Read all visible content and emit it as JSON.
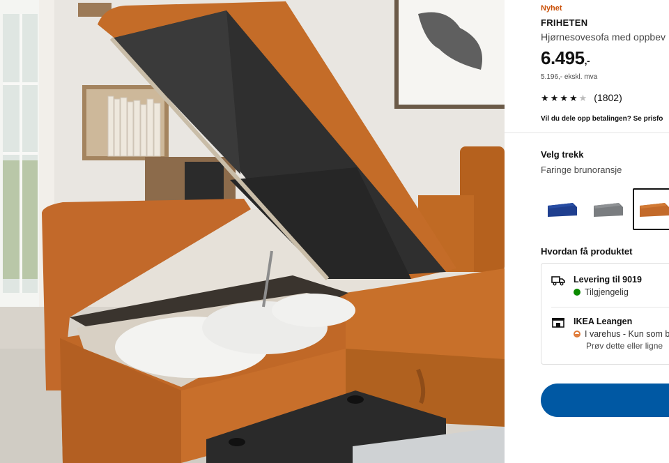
{
  "product": {
    "badge": "Nyhet",
    "name": "FRIHETEN",
    "description": "Hjørnesovesofa med oppbev",
    "price": "6.495",
    "price_suffix": ",-",
    "price_ex_vat": "5.196,- ekskl. mva",
    "rating": 4,
    "rating_max": 5,
    "rating_count": "(1802)",
    "payment_text": "Vil du dele opp betalingen? Se prisfo"
  },
  "cover": {
    "title": "Velg trekk",
    "selected_value": "Faringe brunoransje",
    "swatches": [
      {
        "name": "blue",
        "color": "#1f3f8f"
      },
      {
        "name": "grey",
        "color": "#7a7d80"
      },
      {
        "name": "brown-orange",
        "color": "#c36a2a",
        "selected": true
      }
    ]
  },
  "delivery": {
    "title": "Hvordan få produktet",
    "shipping": {
      "label": "Levering til 9019",
      "status": "Tilgjengelig",
      "status_color": "#0a8a00",
      "icon": "truck-icon"
    },
    "store": {
      "label": "IKEA Leangen",
      "status": "I varehus - Kun som b",
      "sub": "Prøv dette eller ligne",
      "status_color": "#e07b39",
      "icon": "store-icon"
    }
  },
  "cart_button": {
    "color": "#0058a3"
  },
  "colors": {
    "accent": "#ca5008",
    "brand_blue": "#0058a3"
  }
}
